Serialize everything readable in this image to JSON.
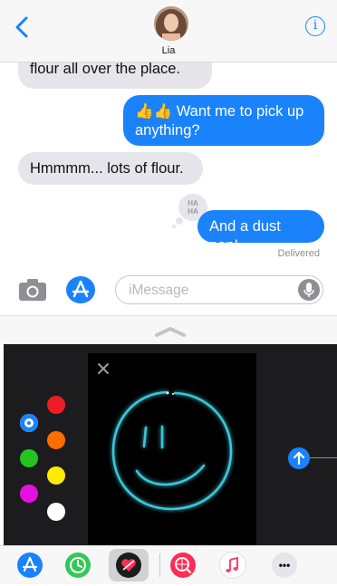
{
  "header": {
    "contact_name": "Lia",
    "back_icon": "chevron-left-icon",
    "info_icon": "info-icon",
    "info_glyph": "i"
  },
  "messages": [
    {
      "direction": "incoming",
      "text": "flour all over the place."
    },
    {
      "direction": "outgoing",
      "emoji": "👍👍",
      "text": "Want me to pick up anything?"
    },
    {
      "direction": "incoming",
      "text": "Hmmmm... lots of flour."
    },
    {
      "direction": "outgoing",
      "text": "And a dust pan!",
      "tapback": "HA HA"
    }
  ],
  "tapback_lines": [
    "HA",
    "HA"
  ],
  "status": {
    "delivered": "Delivered"
  },
  "composer": {
    "placeholder": "iMessage",
    "camera_icon": "camera-icon",
    "appstore_icon": "app-store-icon",
    "mic_icon": "microphone-icon"
  },
  "digital_touch": {
    "colors": [
      "#1a82fb",
      "#ee1c24",
      "#ff6d00",
      "#22c51f",
      "#ffea00",
      "#e510e0",
      "#ffffff"
    ],
    "selected_color": "#1a82fb",
    "sketch_color": "#3cc5d8",
    "close_icon": "close-icon",
    "send_icon": "arrow-up-icon"
  },
  "app_strip": {
    "icons": [
      "app-store-icon",
      "recents-icon",
      "digital-touch-icon",
      "search-images-icon",
      "music-icon",
      "more-icon"
    ],
    "selected": "digital-touch-icon",
    "more_label": "•••"
  },
  "colors": {
    "accent": "#1a82fb",
    "incoming_bubble": "#e6e5eb",
    "drawing_bg": "#000000"
  }
}
